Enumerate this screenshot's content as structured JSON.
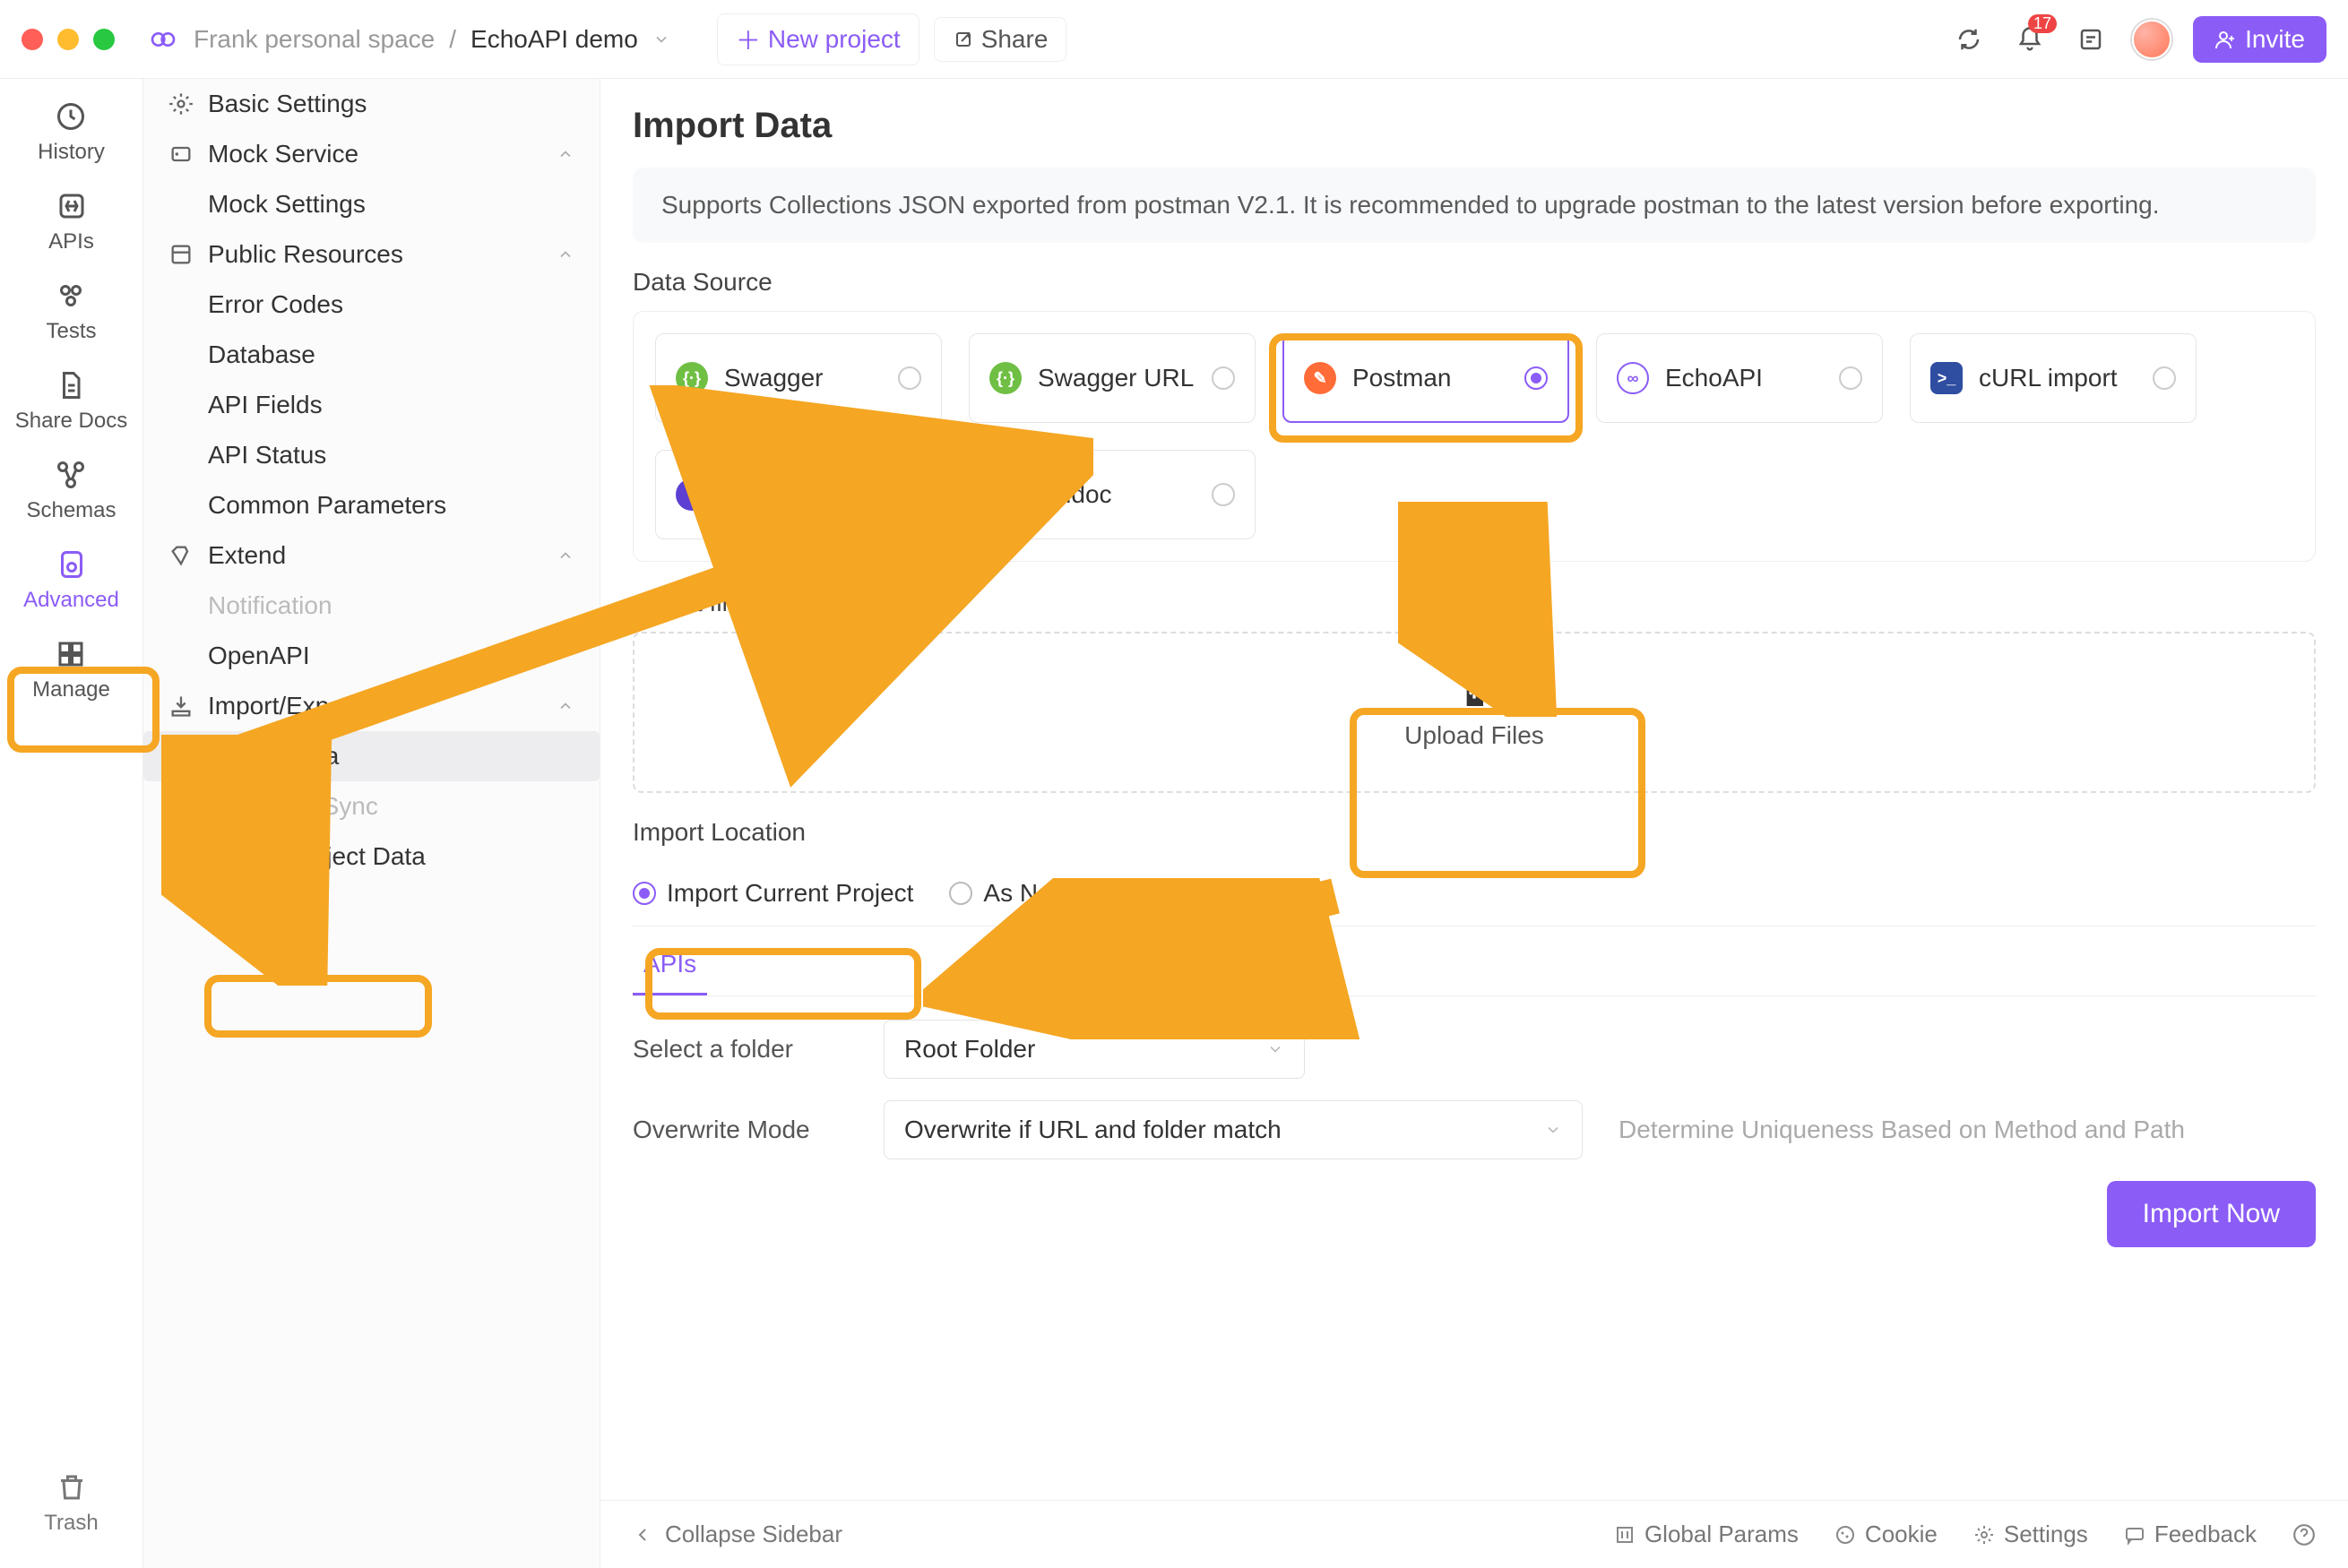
{
  "titlebar": {
    "space": "Frank personal space",
    "project": "EchoAPI demo",
    "new_project": "New project",
    "share": "Share",
    "badge": "17",
    "invite": "Invite"
  },
  "rail": {
    "history": "History",
    "apis": "APIs",
    "tests": "Tests",
    "sharedocs": "Share Docs",
    "schemas": "Schemas",
    "advanced": "Advanced",
    "manage": "Manage",
    "trash": "Trash"
  },
  "sidebar": {
    "basic": "Basic Settings",
    "mock_service": "Mock Service",
    "mock_settings": "Mock Settings",
    "public_res": "Public Resources",
    "error_codes": "Error Codes",
    "database": "Database",
    "api_fields": "API Fields",
    "api_status": "API Status",
    "common_params": "Common Parameters",
    "extend": "Extend",
    "notification": "Notification",
    "openapi": "OpenAPI",
    "import_export": "Import/Export",
    "import_data": "Import Data",
    "realtime": "Real-time Sync",
    "export": "Export Project Data",
    "collapse": "Collapse Sidebar"
  },
  "content": {
    "title": "Import Data",
    "info": "Supports Collections JSON exported from postman V2.1. It is recommended to upgrade postman to the latest version before exporting.",
    "data_source": "Data Source",
    "sources": {
      "swagger": "Swagger",
      "swagger_url": "Swagger URL",
      "postman": "Postman",
      "echoapi": "EchoAPI",
      "curl": "cURL import",
      "insomnia": "insomnia",
      "apidoc": "apidoc"
    },
    "select_files": "Select files",
    "upload": "Upload Files",
    "import_location": "Import Location",
    "loc_current": "Import Current Project",
    "loc_new": "As New Project",
    "tab_apis": "APIs",
    "folder_label": "Select a folder",
    "folder_value": "Root Folder",
    "overwrite_label": "Overwrite Mode",
    "overwrite_value": "Overwrite if URL and folder match",
    "overwrite_hint": "Determine Uniqueness Based on Method and Path",
    "import_now": "Import Now"
  },
  "footer": {
    "global": "Global Params",
    "cookie": "Cookie",
    "settings": "Settings",
    "feedback": "Feedback"
  }
}
